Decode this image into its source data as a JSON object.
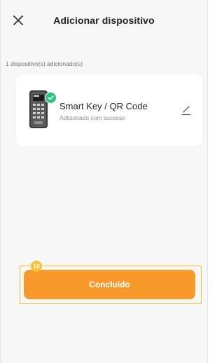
{
  "header": {
    "title": "Adicionar dispositivo",
    "close_icon": "close-icon"
  },
  "summary": {
    "added_count_text": "1 dispositivo(s) adicionado(s)"
  },
  "device": {
    "name": "Smart Key / QR Code",
    "status": "Adicionado com sucesso",
    "icon": "keypad-device-image",
    "status_icon": "check-icon",
    "edit_icon": "pencil-icon"
  },
  "footer": {
    "done_label": "Concluído",
    "marker_number": "10"
  },
  "colors": {
    "accent": "#f7992b",
    "success": "#2ec47d",
    "highlight": "#f5c033",
    "background": "#f6f6f6"
  }
}
